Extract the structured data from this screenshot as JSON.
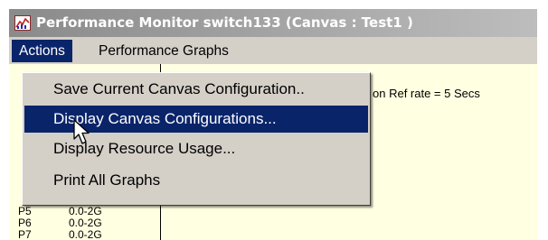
{
  "window": {
    "title": "Performance Monitor switch133 (Canvas : Test1 )",
    "app_icon": "performance-monitor-icon"
  },
  "menubar": {
    "actions_label": "Actions",
    "graphs_label": "Performance Graphs"
  },
  "actions_menu": {
    "items": [
      {
        "label": "Save Current Canvas Configuration..",
        "selected": false
      },
      {
        "label": "Display Canvas Configurations...",
        "selected": true
      },
      {
        "label": "Display Resource Usage...",
        "selected": false
      },
      {
        "label": "Print All Graphs",
        "selected": false
      }
    ]
  },
  "content": {
    "info_text": "on Ref rate = 5 Secs",
    "ports": [
      {
        "name": "P5",
        "range": "0.0-2G"
      },
      {
        "name": "P6",
        "range": "0.0-2G"
      },
      {
        "name": "P7",
        "range": "0.0-2G"
      }
    ]
  },
  "colors": {
    "selection": "#0a246a",
    "content_background": "#ffffe1",
    "chrome": "#d4d0c8"
  }
}
